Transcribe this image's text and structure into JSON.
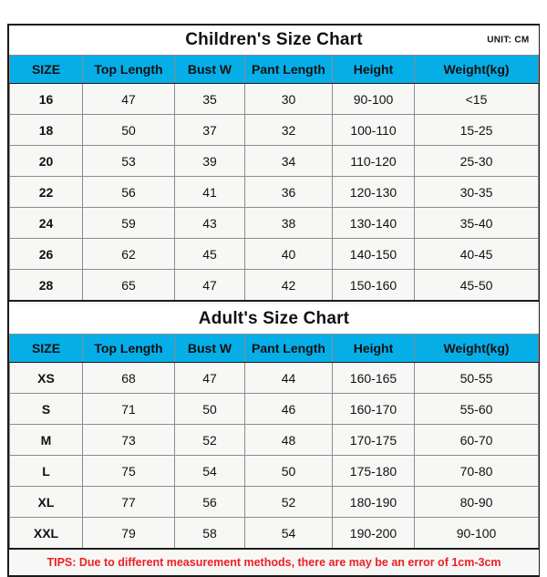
{
  "children": {
    "title": "Children's Size Chart",
    "unit_label": "UNIT: CM",
    "columns": [
      "SIZE",
      "Top Length",
      "Bust W",
      "Pant Length",
      "Height",
      "Weight(kg)"
    ],
    "rows": [
      [
        "16",
        "47",
        "35",
        "30",
        "90-100",
        "<15"
      ],
      [
        "18",
        "50",
        "37",
        "32",
        "100-110",
        "15-25"
      ],
      [
        "20",
        "53",
        "39",
        "34",
        "110-120",
        "25-30"
      ],
      [
        "22",
        "56",
        "41",
        "36",
        "120-130",
        "30-35"
      ],
      [
        "24",
        "59",
        "43",
        "38",
        "130-140",
        "35-40"
      ],
      [
        "26",
        "62",
        "45",
        "40",
        "140-150",
        "40-45"
      ],
      [
        "28",
        "65",
        "47",
        "42",
        "150-160",
        "45-50"
      ]
    ]
  },
  "adult": {
    "title": "Adult's Size Chart",
    "columns": [
      "SIZE",
      "Top Length",
      "Bust W",
      "Pant Length",
      "Height",
      "Weight(kg)"
    ],
    "rows": [
      [
        "XS",
        "68",
        "47",
        "44",
        "160-165",
        "50-55"
      ],
      [
        "S",
        "71",
        "50",
        "46",
        "160-170",
        "55-60"
      ],
      [
        "M",
        "73",
        "52",
        "48",
        "170-175",
        "60-70"
      ],
      [
        "L",
        "75",
        "54",
        "50",
        "175-180",
        "70-80"
      ],
      [
        "XL",
        "77",
        "56",
        "52",
        "180-190",
        "80-90"
      ],
      [
        "XXL",
        "79",
        "58",
        "54",
        "190-200",
        "90-100"
      ]
    ]
  },
  "tips": "TIPS: Due to different measurement methods, there are may be an error of 1cm-3cm",
  "colors": {
    "header_blue": "#06aee8",
    "tips_red": "#ec2027",
    "border_dark": "#1a1a1a",
    "cell_background": "#f7f7f5"
  }
}
